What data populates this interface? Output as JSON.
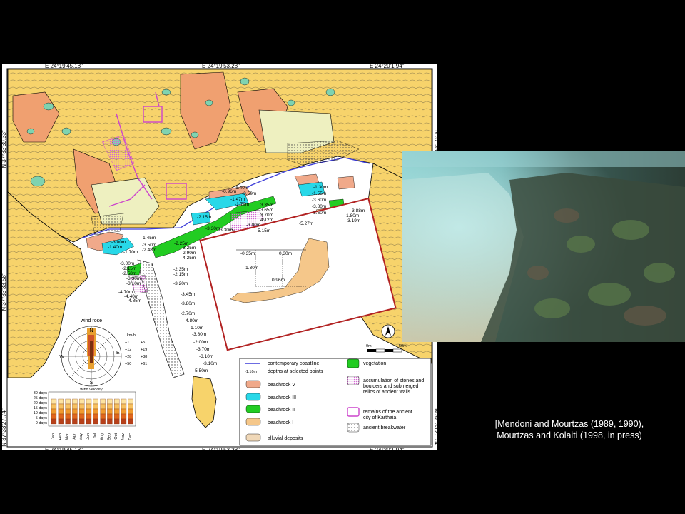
{
  "map": {
    "coords_top": [
      "E 24°19'45.18\"",
      "E 24°19'53.28\"",
      "E 24°20'1.94\""
    ],
    "coords_bottom": [
      "E 24°19'45.18\"",
      "E 24°19'53.28\"",
      "E 24°20'1.94\""
    ],
    "coords_left": [
      "N 37°33'39.33\"",
      "N 37°33'33.58\"",
      "N 37°33'27.74\""
    ],
    "coords_right": [
      "N 37°33'39.33\"",
      "N 37°33'33.58\"",
      "N 37°33'27.74\""
    ],
    "depths": [
      "-0.96m",
      "-1.40m",
      "-3.50m",
      "-1.47m",
      "-1.70m",
      "3.35m",
      "3.65m",
      "3.70m",
      "4.12m",
      "-3.00m",
      "-5.15m",
      "-2.15m",
      "-3.30m",
      "-3.30m",
      "-1.45m",
      "-3.00m",
      "-1.40m",
      "-1.70m",
      "-3.50m",
      "-2.48m",
      "-2.25m",
      "-3.25m",
      "-2.90m",
      "-4.25m",
      "-3.00m",
      "-2.15m",
      "-2.50m",
      "-3.30m",
      "-3.10m",
      "-4.70m",
      "-4.40m",
      "-4.85m",
      "-2.35m",
      "-2.15m",
      "-3.20m",
      "-3.45m",
      "-3.80m",
      "-2.70m",
      "-4.80m",
      "-1.10m",
      "-3.80m",
      "-2.00m",
      "-3.70m",
      "-3.10m",
      "-3.10m",
      "-5.50m",
      "-1.30m",
      "-1.55m",
      "-3.60m",
      "-3.80m",
      "-3.60m",
      "-5.27m",
      "-3.88m",
      "-1.80m",
      "-3.19m"
    ],
    "inset_labels": [
      "-0.35m",
      "0.30m",
      "-1.30m",
      "0.96m"
    ],
    "wind_rose": {
      "title": "wind rose",
      "directions": [
        "N",
        "S",
        "E",
        "W"
      ],
      "units": "km/h",
      "speed_classes": [
        "+1",
        "+5",
        "+12",
        "+19",
        "+28",
        "+38",
        "+50",
        "+61"
      ],
      "footer": "wind velocity"
    },
    "calm_chart": {
      "y_ticks": [
        "30 days",
        "25 days",
        "20 days",
        "15 days",
        "10 days",
        "5 days",
        "0 days"
      ],
      "months": [
        "Jan",
        "Feb",
        "Mar",
        "Apr",
        "May",
        "Jun",
        "Jul",
        "Aug",
        "Sep",
        "Oct",
        "Nov",
        "Dec"
      ]
    },
    "scale": {
      "start": "0m",
      "end": "50m"
    },
    "legend": {
      "left": [
        {
          "label": "contemporary coastline",
          "swatch": "line",
          "color": "#3b3bd8"
        },
        {
          "label": "depths at selected points",
          "swatch": "depth",
          "sample": "-1.10m"
        },
        {
          "label": "beachrock V",
          "swatch": "fill",
          "color": "#f0a98a"
        },
        {
          "label": "beachrock III",
          "swatch": "fill",
          "color": "#28d8e8"
        },
        {
          "label": "beachrock II",
          "swatch": "fill",
          "color": "#22cc22"
        },
        {
          "label": "beachrock I",
          "swatch": "fill",
          "color": "#f5c78a"
        },
        {
          "label": "alluvial deposits",
          "swatch": "fill",
          "color": "#f0d8b8"
        }
      ],
      "right": [
        {
          "label": "vegetation",
          "swatch": "fill",
          "color": "#22cc22"
        },
        {
          "label": "accumulation of stones and boulders and submerged relics of ancient walls",
          "swatch": "dots",
          "color": "#d36ad3"
        },
        {
          "label": "remains of the ancient city of Karthaia",
          "swatch": "outline",
          "color": "#cc44cc"
        },
        {
          "label": "ancient breakwater",
          "swatch": "pattern",
          "color": "#888888"
        }
      ]
    },
    "colors": {
      "rock": "#f7d36b",
      "terrace": "#f0a070",
      "pale": "#eef0c0",
      "veg": "#7fd3b0",
      "sea": "#ffffff",
      "inset_box": "#b22222"
    }
  },
  "caption": {
    "line1": "[Mendoni and Mourtzas (1989, 1990),",
    "line2": "Mourtzas and Kolaiti (1998, in press)"
  }
}
